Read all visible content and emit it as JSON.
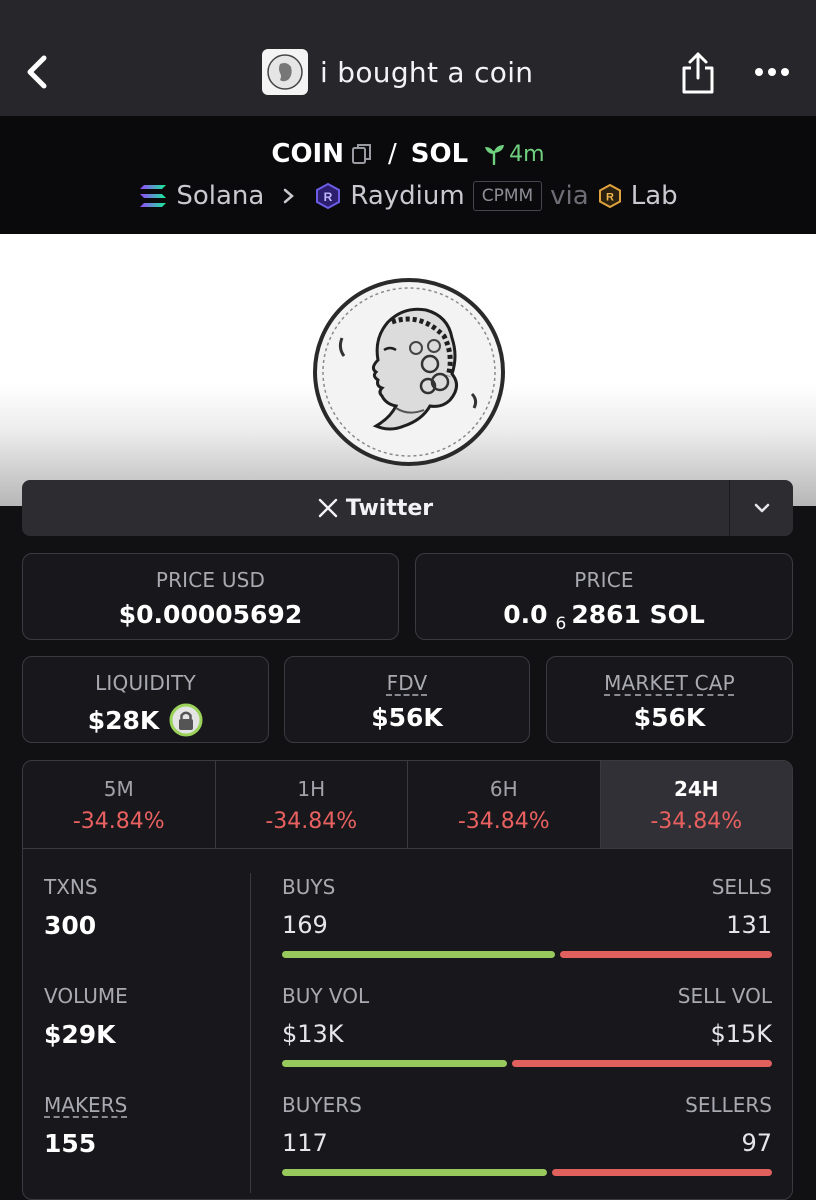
{
  "header": {
    "title": "i bought a coin",
    "back_icon": "chevron-left-icon",
    "share_icon": "share-icon",
    "more_icon": "more-dots-icon"
  },
  "pair": {
    "base": "COIN",
    "separator": "/",
    "quote": "SOL",
    "age": "4m",
    "chain": "Solana",
    "dex": "Raydium",
    "pool_type": "CPMM",
    "via_label": "via",
    "launchpad": "Lab"
  },
  "socials": {
    "twitter_label": "Twitter"
  },
  "prices": {
    "price_usd_label": "PRICE USD",
    "price_usd": "$0.00005692",
    "price_label": "PRICE",
    "price_native_prefix": "0.0",
    "price_native_zeros": "6",
    "price_native_digits": "2861 SOL"
  },
  "metrics": {
    "liquidity_label": "LIQUIDITY",
    "liquidity": "$28K",
    "fdv_label": "FDV",
    "fdv": "$56K",
    "mcap_label": "MARKET CAP",
    "mcap": "$56K"
  },
  "changes": {
    "tabs": [
      {
        "label": "5M",
        "value": "-34.84%"
      },
      {
        "label": "1H",
        "value": "-34.84%"
      },
      {
        "label": "6H",
        "value": "-34.84%"
      },
      {
        "label": "24H",
        "value": "-34.84%"
      }
    ],
    "active_tab": "24H"
  },
  "stats": {
    "txns_label": "TXNS",
    "txns": "300",
    "buys_label": "BUYS",
    "buys": "169",
    "sells_label": "SELLS",
    "sells": "131",
    "volume_label": "VOLUME",
    "volume": "$29K",
    "buy_vol_label": "BUY VOL",
    "buy_vol": "$13K",
    "sell_vol_label": "SELL VOL",
    "sell_vol": "$15K",
    "makers_label": "MAKERS",
    "makers": "155",
    "buyers_label": "BUYERS",
    "buyers": "117",
    "sellers_label": "SELLERS",
    "sellers": "97",
    "txns_buy_share": 0.563,
    "volume_buy_share": 0.464,
    "makers_buy_share": 0.547
  },
  "colors": {
    "positive": "#97c95c",
    "negative": "#e0605e",
    "age_green": "#6fd07f"
  }
}
